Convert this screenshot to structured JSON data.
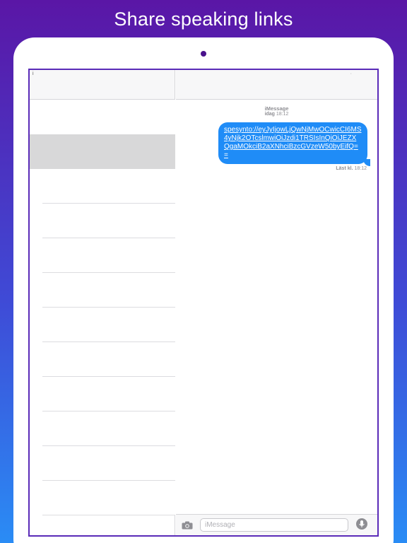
{
  "promo": {
    "headline": "Share speaking links"
  },
  "sidebar": {
    "status_glyph": "i",
    "conversations": [
      {
        "selected": false
      },
      {
        "selected": true
      },
      {
        "selected": false
      },
      {
        "selected": false
      },
      {
        "selected": false
      },
      {
        "selected": false
      },
      {
        "selected": false
      },
      {
        "selected": false
      },
      {
        "selected": false
      },
      {
        "selected": false
      },
      {
        "selected": false
      },
      {
        "selected": false
      }
    ]
  },
  "chat": {
    "header_glyph": "·",
    "service_label": "iMessage",
    "timestamp_day": "idag",
    "timestamp_time": "18:12",
    "message": {
      "text": "spesynto://eyJyIjowLjQwNjMwOCwicCI6MS4yNjk2OTcslmwiOiJzdi1TRSIsInQiOiJEZXQgaMOkciB2aXNhciBzcGVzeW50byEifQ==",
      "bubble_color": "#1f8cf7"
    },
    "read_receipt_label": "Läst kl.",
    "read_receipt_time": "18:12",
    "input": {
      "placeholder": "iMessage"
    }
  },
  "icons": {
    "camera": "camera-icon",
    "microphone": "microphone-icon"
  },
  "colors": {
    "background_top": "#5a16a6",
    "background_bottom": "#2a8cf5",
    "accent": "#1f8cf7",
    "frame_border": "#5a2bb8"
  }
}
